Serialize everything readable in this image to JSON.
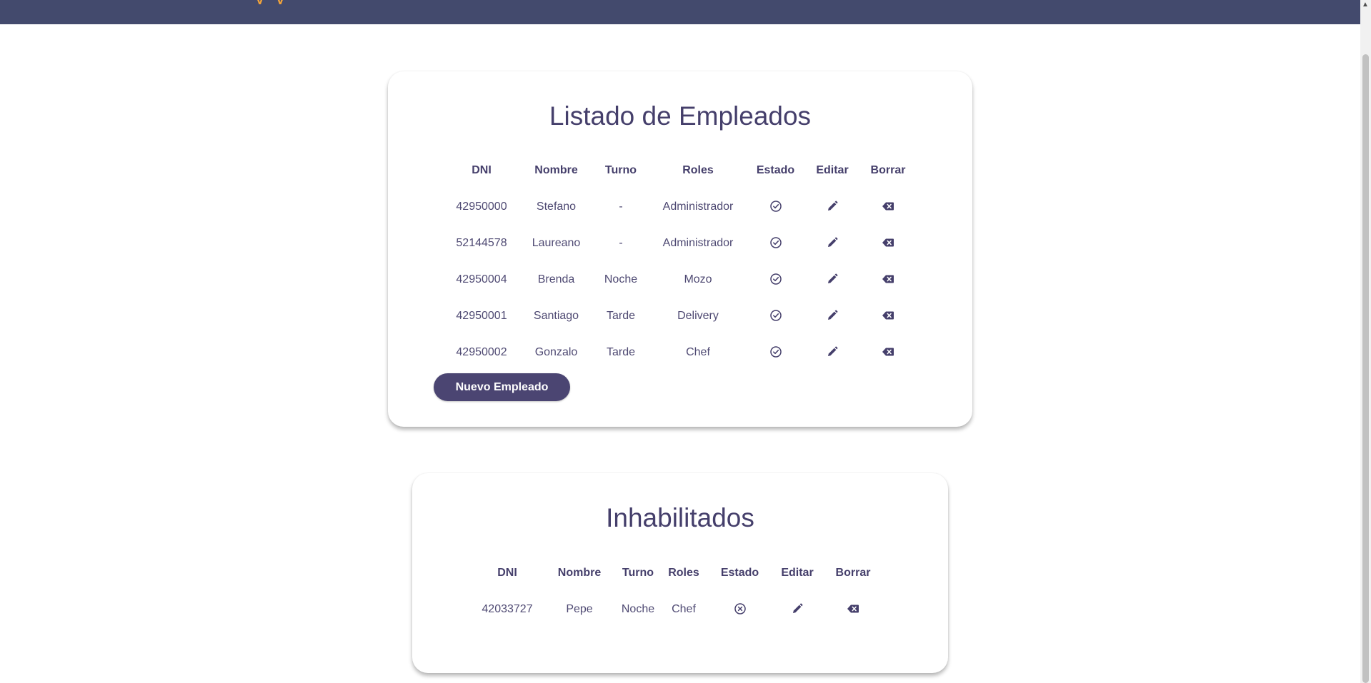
{
  "header": {
    "logo_text": "y y"
  },
  "main": {
    "title": "Listado de Empleados",
    "columns": [
      "DNI",
      "Nombre",
      "Turno",
      "Roles",
      "Estado",
      "Editar",
      "Borrar"
    ],
    "rows": [
      {
        "dni": "42950000",
        "nombre": "Stefano",
        "turno": "-",
        "roles": "Administrador",
        "estado": "active"
      },
      {
        "dni": "52144578",
        "nombre": "Laureano",
        "turno": "-",
        "roles": "Administrador",
        "estado": "active"
      },
      {
        "dni": "42950004",
        "nombre": "Brenda",
        "turno": "Noche",
        "roles": "Mozo",
        "estado": "active"
      },
      {
        "dni": "42950001",
        "nombre": "Santiago",
        "turno": "Tarde",
        "roles": "Delivery",
        "estado": "active"
      },
      {
        "dni": "42950002",
        "nombre": "Gonzalo",
        "turno": "Tarde",
        "roles": "Chef",
        "estado": "active"
      }
    ],
    "new_button_label": "Nuevo Empleado"
  },
  "disabled": {
    "title": "Inhabilitados",
    "columns": [
      "DNI",
      "Nombre",
      "Turno",
      "Roles",
      "Estado",
      "Editar",
      "Borrar"
    ],
    "rows": [
      {
        "dni": "42033727",
        "nombre": "Pepe",
        "turno": "Noche",
        "roles": "Chef",
        "estado": "inactive"
      }
    ]
  },
  "icons": {
    "estado_active": "check-circle-icon",
    "estado_inactive": "x-circle-icon",
    "edit": "pencil-icon",
    "delete": "backspace-icon"
  },
  "colors": {
    "header_bg": "#434a6d",
    "primary": "#453f6b",
    "button_bg": "#4b4572",
    "logo_accent": "#f2a33a"
  }
}
